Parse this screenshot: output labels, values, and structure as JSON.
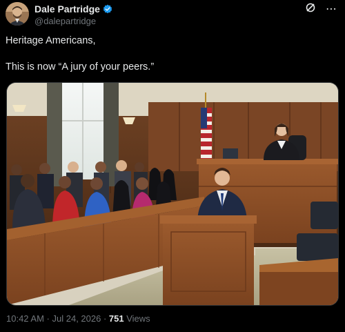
{
  "author": {
    "display_name": "Dale Partridge",
    "handle": "@dalepartridge",
    "verified": true,
    "avatar_icon": "profile-photo"
  },
  "actions": {
    "grok_icon": "grok-icon",
    "more_icon": "more-icon",
    "more_label": "⋯"
  },
  "tweet": {
    "line1": "Heritage Americans,",
    "line2": "This is now “A jury of your peers.”"
  },
  "media": {
    "kind": "image",
    "description_icon": "courtroom-image"
  },
  "meta": {
    "time": "10:42 AM",
    "separator1": " · ",
    "date": "Jul 24, 2026",
    "separator2": " · ",
    "views": "751",
    "views_label": " Views"
  },
  "colors": {
    "background": "#000000",
    "text": "#e7e9ea",
    "muted": "#71767b",
    "verified": "#1d9bf0"
  }
}
